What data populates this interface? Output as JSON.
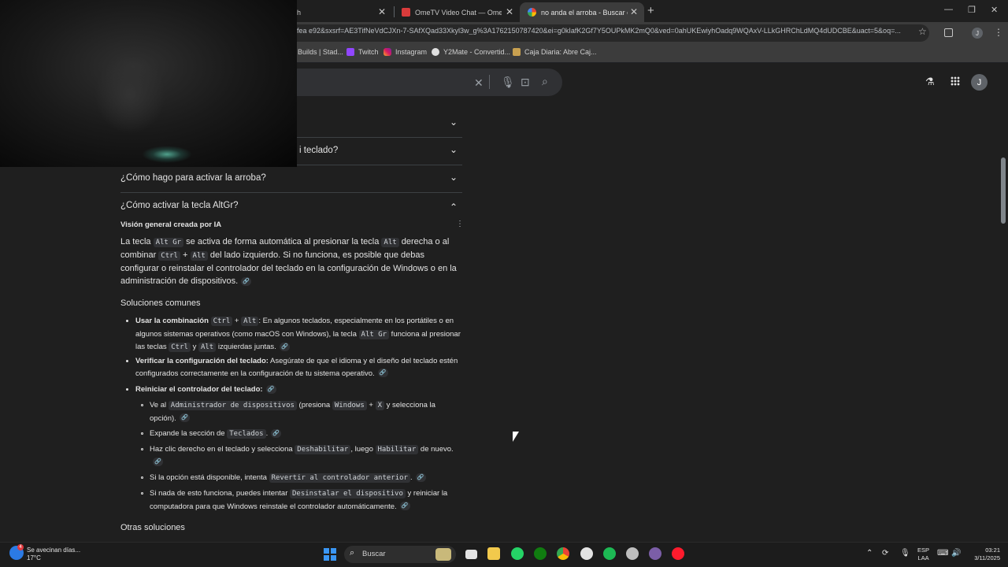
{
  "browser": {
    "tabs": [
      {
        "label": "tch"
      },
      {
        "label": "OmeTV Video Chat — Omegle"
      },
      {
        "label": "no anda el arroba - Buscar con"
      }
    ],
    "url": "fea e92&sxsrf=AE3TifNeVdCJXn-7-SAfXQad33Xkyl3w_g%3A1762150787420&ei=g0kIafK2Gf7Y5OUPkMK2mQ0&ved=0ahUKEwiyhOadq9WQAxV-LLkGHRChLdMQ4dUDCBE&uact=5&oq=...",
    "bookmarks": [
      {
        "label": "Builds | Stad..."
      },
      {
        "label": "Twitch"
      },
      {
        "label": "Instagram"
      },
      {
        "label": "Y2Mate - Convertid..."
      },
      {
        "label": "Caja Diaria: Abre Caj..."
      }
    ],
    "avatar_initial": "J"
  },
  "google": {
    "avatar_initial": "J",
    "faq": [
      {
        "question": ""
      },
      {
        "question": "i teclado?"
      },
      {
        "question": "¿Cómo hago para activar la arroba?"
      },
      {
        "question": "¿Cómo activar la tecla AltGr?"
      }
    ],
    "ai_label": "Visión general creada por IA",
    "para": {
      "t1": "La tecla ",
      "c1": "Alt Gr",
      "t2": " se activa de forma automática al presionar la tecla ",
      "c2": "Alt",
      "t3": " derecha o al combinar ",
      "c3": "Ctrl",
      "t4": " + ",
      "c4": "Alt",
      "t5": " del lado izquierdo. Si no funciona, es posible que debas configurar o reinstalar el controlador del teclado en la configuración de Windows o en la administración de dispositivos."
    },
    "soluciones_title": "Soluciones comunes",
    "sol1": {
      "b": "Usar la combinación ",
      "c1": "Ctrl",
      "t1": " + ",
      "c2": "Alt",
      "t2": ": En algunos teclados, especialmente en los portátiles o en algunos sistemas operativos (como macOS con Windows), la tecla ",
      "c3": "Alt Gr",
      "t3": " funciona al presionar las teclas ",
      "c4": "Ctrl",
      "t4": " y ",
      "c5": "Alt",
      "t5": " izquierdas juntas."
    },
    "sol2": {
      "b": "Verificar la configuración del teclado:",
      "t1": " Asegúrate de que el idioma y el diseño del teclado estén configurados correctamente en la configuración de tu sistema operativo."
    },
    "sol3": {
      "b": "Reiniciar el controlador del teclado:"
    },
    "sub1": {
      "t1": "Ve al ",
      "c1": "Administrador de dispositivos",
      "t2": " (presiona ",
      "c2": "Windows",
      "t3": " + ",
      "c3": "X",
      "t4": " y selecciona la opción)."
    },
    "sub2": {
      "t1": "Expande la sección de ",
      "c1": "Teclados",
      "t2": "."
    },
    "sub3": {
      "t1": "Haz clic derecho en el teclado y selecciona ",
      "c1": "Deshabilitar",
      "t2": ", luego ",
      "c2": "Habilitar",
      "t3": " de nuevo."
    },
    "sub4": {
      "t1": "Si la opción está disponible, intenta ",
      "c1": "Revertir al controlador anterior",
      "t2": "."
    },
    "sub5": {
      "t1": "Si nada de esto funciona, puedes intentar ",
      "c1": "Desinstalar el dispositivo",
      "t2": " y reiniciar la computadora para que Windows reinstale el controlador automáticamente."
    },
    "otras_title": "Otras soluciones"
  },
  "taskbar": {
    "weather_title": "Se avecinan días...",
    "weather_temp": "17°C",
    "weather_badge": "4",
    "search_label": "Buscar",
    "lang_1": "ESP",
    "lang_2": "LAA",
    "time": "03:21",
    "date": "3/11/2025"
  }
}
